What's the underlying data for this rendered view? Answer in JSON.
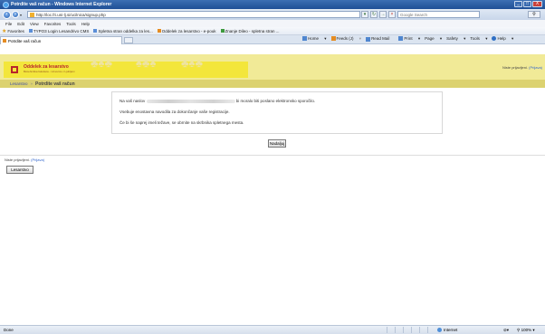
{
  "window": {
    "title": "Potrdite vaš račun - Windows Internet Explorer",
    "buttons": [
      "_",
      "□",
      "X"
    ]
  },
  "address_bar": {
    "url": "http://loc.fri.uni-lj.si/ucilnica/signup.php",
    "search_placeholder": "Google Search"
  },
  "menu": [
    "File",
    "Edit",
    "View",
    "Favorites",
    "Tools",
    "Help"
  ],
  "favorites_bar": {
    "label": "Favorites",
    "items": [
      "TYPO3 Login Lesandrivo CMS",
      "Spletna stran oddelka za les...",
      "Oddelek za lesarstvo - e-pouk",
      "Znanje Dileo - spletna stran ..."
    ]
  },
  "tab": {
    "title": "Potrdite vaš račun"
  },
  "command_bar": [
    "Page",
    "Safety",
    "Tools",
    "Help",
    "Feeds (J)",
    "Read Mail",
    "Print",
    "Home"
  ],
  "banner": {
    "title": "Oddelek za lesarstvo",
    "subtitle": "Biotehniška fakulteta - Univerza v Ljubljani",
    "login_text": "Niste prijavljeni.",
    "login_link": "(Prijava)"
  },
  "breadcrumb": {
    "home": "Lesarstvo",
    "separator": "»",
    "current": "Potrdite vaš račun"
  },
  "message": {
    "line1_before": "Na vaš naslov",
    "line1_after": "bi moralo biti poslano elektronsko sporočilo.",
    "line2": "Vsebuje enostavna navodila za dokončanje vaše registracije.",
    "line3": "Če bi še naprej imeli težave, se obrnite na skrbnika spletnega mesta."
  },
  "continue_button": "Nadaljuj",
  "footer": {
    "login_text": "Niste prijavljeni.",
    "login_link": "(Prijava)",
    "home_button": "Lesarstvo"
  },
  "status_bar": {
    "status": "Done",
    "zone": "Internet",
    "zoom": "100%"
  }
}
